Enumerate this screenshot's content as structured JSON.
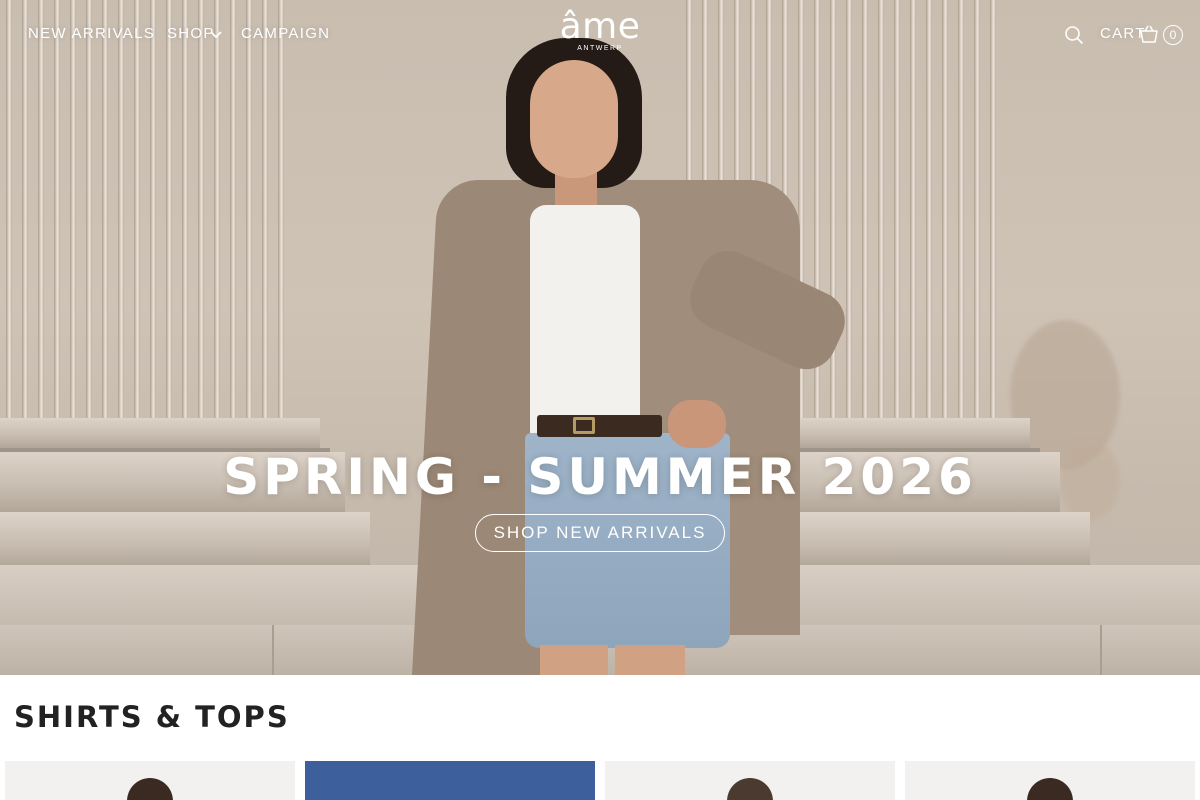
{
  "header": {
    "nav": [
      "NEW ARRIVALS",
      "SHOP",
      "CAMPAIGN"
    ],
    "logo": {
      "word": "âme",
      "sub": "ANTWERP"
    },
    "cart_label": "CART",
    "cart_count": "0",
    "icons": {
      "search": "search-icon",
      "cart": "shopping-basket-icon",
      "shop_dropdown": "chevron-down-icon"
    }
  },
  "hero": {
    "title": "SPRING - SUMMER 2026",
    "button": "SHOP NEW ARRIVALS"
  },
  "section": {
    "title": "SHIRTS & TOPS",
    "cards": [
      {
        "background": "#f2f1ef"
      },
      {
        "background": "#3d5f9c"
      },
      {
        "background": "#f2f1ef"
      },
      {
        "background": "#f2f1ef"
      }
    ]
  },
  "colors": {
    "text_dark": "#222222",
    "hero_text": "#ffffff"
  }
}
